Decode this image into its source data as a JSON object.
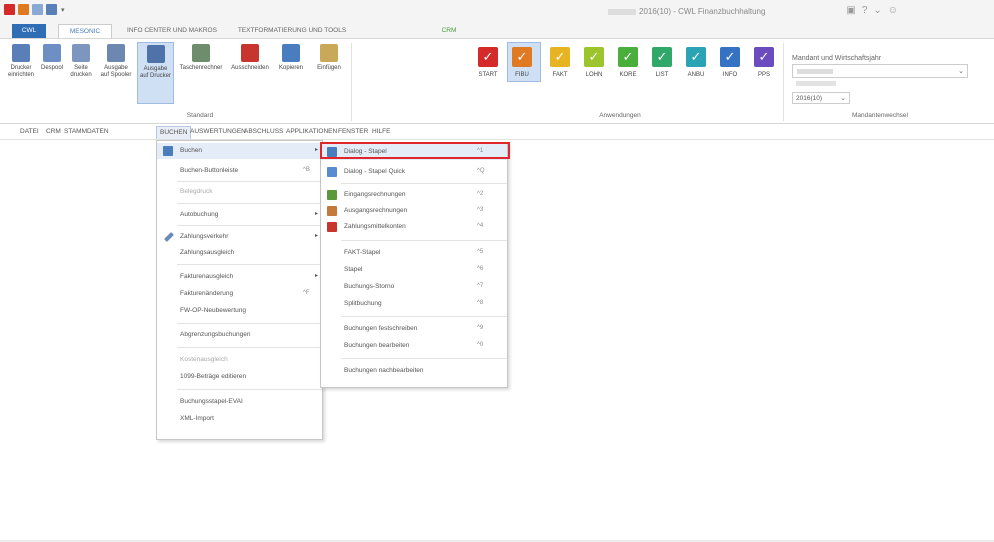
{
  "app": {
    "title_suffix": "2016(10) - CWL Finanzbuchhaltung",
    "window_controls": [
      "▣",
      "?",
      "⌄",
      "☺"
    ]
  },
  "ribbon_tabs": [
    {
      "label": "CWL"
    },
    {
      "label": "MESONIC"
    },
    {
      "label": "INFO CENTER UND MAKROS"
    },
    {
      "label": "TEXTFORMATIERUNG UND TOOLS"
    },
    {
      "label": "CRM"
    }
  ],
  "ribbon": {
    "standard_buttons": [
      {
        "label": "Drucker\neinrichten",
        "icon": "printer-setup-icon",
        "color": "#5a7fb8"
      },
      {
        "label": "Despool",
        "icon": "despool-icon",
        "color": "#6e8fc4"
      },
      {
        "label": "Seite\ndrucken",
        "icon": "page-print-icon",
        "color": "#7c96bf"
      },
      {
        "label": "Ausgabe\nauf Spooler",
        "icon": "spooler-icon",
        "color": "#6c87b0"
      },
      {
        "label": "Ausgabe\nauf Drucker",
        "icon": "output-printer-icon",
        "color": "#4f73a8"
      },
      {
        "label": "Taschenrechner",
        "icon": "calculator-icon",
        "color": "#6d8d6d"
      },
      {
        "label": "Ausschneiden",
        "icon": "cut-icon",
        "color": "#c8352e"
      },
      {
        "label": "Kopieren",
        "icon": "copy-icon",
        "color": "#4a7cc0"
      },
      {
        "label": "Einfügen",
        "icon": "paste-icon",
        "color": "#c9a85a"
      }
    ],
    "standard_group_label": "Standard",
    "apps": [
      {
        "label": "START",
        "color": "#d42a2a"
      },
      {
        "label": "FIBU",
        "color": "#e07a22"
      },
      {
        "label": "FAKT",
        "color": "#e6b422"
      },
      {
        "label": "LOHN",
        "color": "#9cc42c"
      },
      {
        "label": "KORE",
        "color": "#4aae3c"
      },
      {
        "label": "LIST",
        "color": "#2fa86a"
      },
      {
        "label": "ANBU",
        "color": "#2aa4b4"
      },
      {
        "label": "INFO",
        "color": "#3672c4"
      },
      {
        "label": "PPS",
        "color": "#6a4cc0"
      }
    ],
    "apps_group_label": "Anwendungen",
    "mandant_title": "Mandant und Wirtschaftsjahr",
    "year_value": "2016(10)",
    "mandant_group_label": "Mandantenwechsel"
  },
  "menubar": [
    "DATEI",
    "CRM",
    "STAMMDATEN",
    "BUCHEN",
    "AUSWERTUNGEN",
    "ABSCHLUSS",
    "APPLIKATIONEN",
    "FENSTER",
    "HILFE"
  ],
  "menu_buchen": {
    "items": [
      {
        "label": "Buchen",
        "submenu": "▸",
        "icon": "booking-icon"
      },
      {
        "label": "Buchen-Buttonleiste",
        "shortcut": "^B"
      },
      {
        "label": "Belegdruck",
        "disabled": true
      },
      {
        "label": "Autobuchung",
        "submenu": "▸"
      },
      {
        "label": "Zahlungsverkehr",
        "submenu": "▸",
        "icon": "payment-icon"
      },
      {
        "label": "Zahlungsausgleich"
      },
      {
        "label": "Fakturenausgleich",
        "submenu": "▸"
      },
      {
        "label": "Fakturenänderung",
        "shortcut": "^F"
      },
      {
        "label": "FW-OP-Neubewertung"
      },
      {
        "label": "Abgrenzungsbuchungen"
      },
      {
        "label": "Kostenausgleich",
        "disabled": true
      },
      {
        "label": "1099-Beträge editieren"
      },
      {
        "label": "Buchungsstapel-EVAI"
      },
      {
        "label": "XML-Import"
      }
    ]
  },
  "menu_submenu": {
    "items": [
      {
        "label": "Dialog - Stapel",
        "shortcut": "^1",
        "icon": "dialog-icon"
      },
      {
        "label": "Dialog - Stapel Quick",
        "shortcut": "^Q",
        "icon": "dialog-quick-icon"
      },
      {
        "label": "Eingangsrechnungen",
        "shortcut": "^2",
        "icon": "incoming-invoice-icon"
      },
      {
        "label": "Ausgangsrechnungen",
        "shortcut": "^3",
        "icon": "outgoing-invoice-icon"
      },
      {
        "label": "Zahlungsmittelkonten",
        "shortcut": "^4",
        "icon": "payment-account-icon"
      },
      {
        "label": "FAKT-Stapel",
        "shortcut": "^5"
      },
      {
        "label": "Stapel",
        "shortcut": "^6"
      },
      {
        "label": "Buchungs-Storno",
        "shortcut": "^7"
      },
      {
        "label": "Splitbuchung",
        "shortcut": "^8"
      },
      {
        "label": "Buchungen festschreiben",
        "shortcut": "^9"
      },
      {
        "label": "Buchungen bearbeiten",
        "shortcut": "^0"
      },
      {
        "label": "Buchungen nachbearbeiten"
      }
    ]
  }
}
